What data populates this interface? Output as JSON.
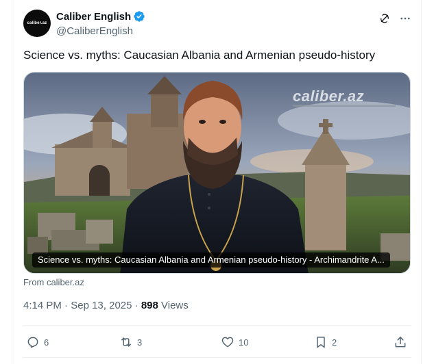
{
  "author": {
    "display_name": "Caliber English",
    "handle": "@CaliberEnglish",
    "avatar_text": "caliber.az"
  },
  "tweet": {
    "text": "Science vs. myths: Caucasian Albania and Armenian pseudo-history"
  },
  "media": {
    "watermark": "caliber.az",
    "caption": "Science vs. myths: Caucasian Albania and Armenian pseudo-history - Archimandrite A..."
  },
  "source": "From caliber.az",
  "meta": {
    "time": "4:14 PM",
    "separator": " · ",
    "date": "Sep 13, 2025",
    "separator2": " · ",
    "views_count": "898",
    "views_label": " Views"
  },
  "actions": {
    "replies": "6",
    "reposts": "3",
    "likes": "10",
    "bookmarks": "2"
  },
  "colors": {
    "verified": "#1d9bf0",
    "secondary_text": "#536471",
    "primary_text": "#0f1419"
  }
}
